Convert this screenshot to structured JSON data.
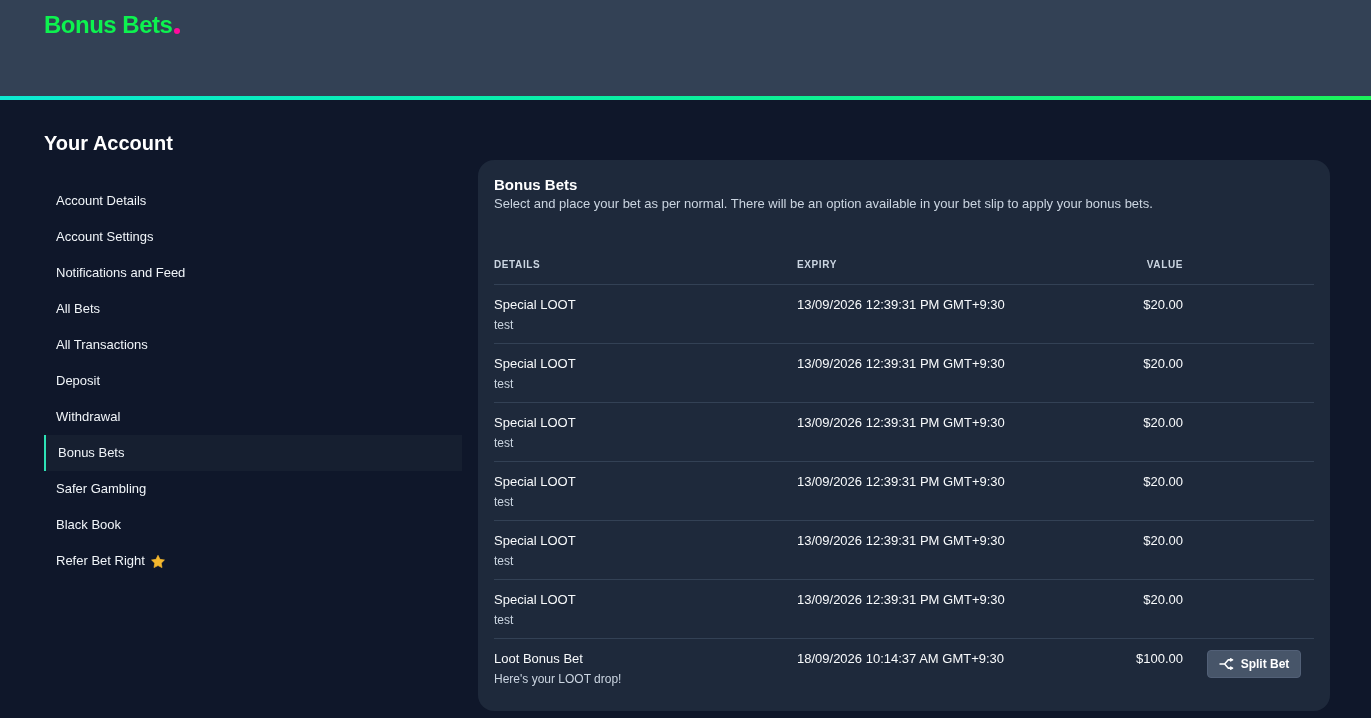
{
  "header": {
    "logo": "Bonus Bets"
  },
  "sidebar": {
    "title": "Your Account",
    "items": [
      {
        "label": "Account Details",
        "selected": false,
        "starred": false
      },
      {
        "label": "Account Settings",
        "selected": false,
        "starred": false
      },
      {
        "label": "Notifications and Feed",
        "selected": false,
        "starred": false
      },
      {
        "label": "All Bets",
        "selected": false,
        "starred": false
      },
      {
        "label": "All Transactions",
        "selected": false,
        "starred": false
      },
      {
        "label": "Deposit",
        "selected": false,
        "starred": false
      },
      {
        "label": "Withdrawal",
        "selected": false,
        "starred": false
      },
      {
        "label": "Bonus Bets",
        "selected": true,
        "starred": false
      },
      {
        "label": "Safer Gambling",
        "selected": false,
        "starred": false
      },
      {
        "label": "Black Book",
        "selected": false,
        "starred": false
      },
      {
        "label": "Refer Bet Right",
        "selected": false,
        "starred": true
      }
    ]
  },
  "panel": {
    "title": "Bonus Bets",
    "description": "Select and place your bet as per normal. There will be an option available in your bet slip to apply your bonus bets.",
    "table": {
      "columns": [
        "DETAILS",
        "EXPIRY",
        "VALUE"
      ],
      "rows": [
        {
          "name": "Special LOOT",
          "note": "test",
          "expiry": "13/09/2026 12:39:31 PM GMT+9:30",
          "value": "$20.00"
        },
        {
          "name": "Special LOOT",
          "note": "test",
          "expiry": "13/09/2026 12:39:31 PM GMT+9:30",
          "value": "$20.00"
        },
        {
          "name": "Special LOOT",
          "note": "test",
          "expiry": "13/09/2026 12:39:31 PM GMT+9:30",
          "value": "$20.00"
        },
        {
          "name": "Special LOOT",
          "note": "test",
          "expiry": "13/09/2026 12:39:31 PM GMT+9:30",
          "value": "$20.00"
        },
        {
          "name": "Special LOOT",
          "note": "test",
          "expiry": "13/09/2026 12:39:31 PM GMT+9:30",
          "value": "$20.00"
        },
        {
          "name": "Special LOOT",
          "note": "test",
          "expiry": "13/09/2026 12:39:31 PM GMT+9:30",
          "value": "$20.00"
        },
        {
          "name": "Loot Bonus Bet",
          "note": "Here's your LOOT drop!",
          "expiry": "18/09/2026 10:14:37 AM GMT+9:30",
          "value": "$100.00",
          "action": "Split Bet"
        }
      ]
    }
  }
}
